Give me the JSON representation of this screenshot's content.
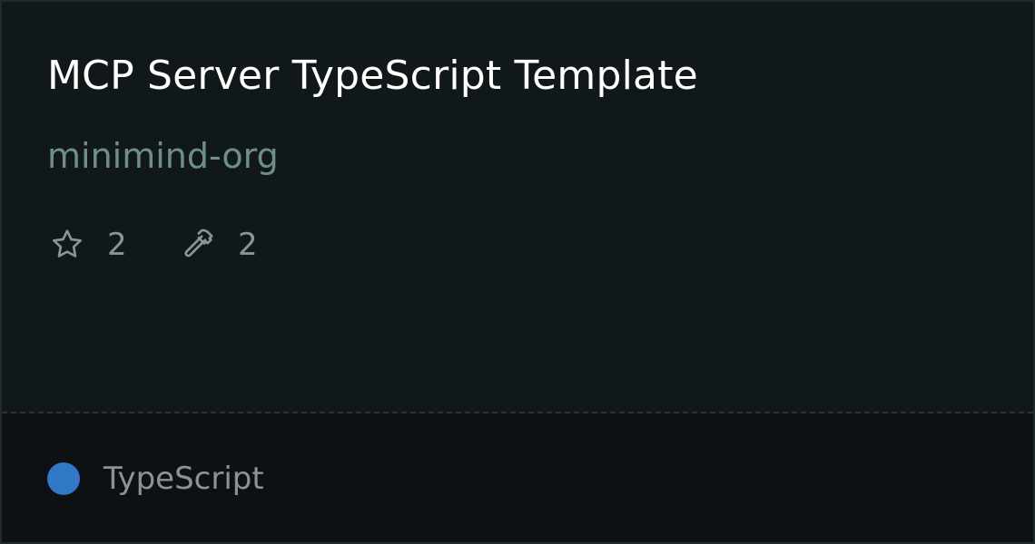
{
  "repo": {
    "title": "MCP Server TypeScript Template",
    "owner": "minimind-org"
  },
  "stats": {
    "stars": {
      "icon": "star-icon",
      "value": "2"
    },
    "forks": {
      "icon": "hammer-icon",
      "value": "2"
    }
  },
  "language": {
    "name": "TypeScript",
    "color": "#3178c6"
  },
  "colors": {
    "background": "#10181a",
    "footer_background": "#0d1114",
    "title": "#ffffff",
    "owner": "#6e8f88",
    "muted_text": "#8b9396"
  }
}
